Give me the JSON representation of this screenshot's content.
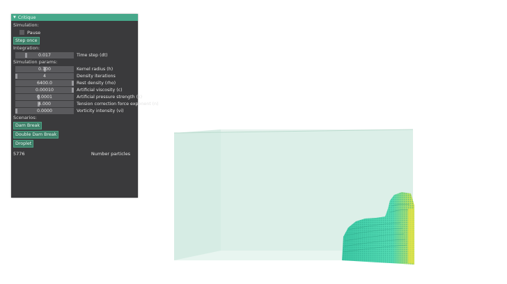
{
  "panel": {
    "title": "Critique",
    "sections": {
      "simulation": "Simulation:",
      "integration": "Integration:",
      "params": "Simulation params:",
      "scenarios": "Scenarios:"
    },
    "pause_label": "Pause",
    "step_once": "Step once",
    "time_step": {
      "value": "0.017",
      "label": "Time step (dt)",
      "level": 0.17
    },
    "params": [
      {
        "value": "0.100",
        "label": "Kernel radius (h)",
        "level": 0.5
      },
      {
        "value": "4",
        "label": "Density iterations",
        "level": 0.0
      },
      {
        "value": "6400.0",
        "label": "Rest density (rho)",
        "level": 1.0
      },
      {
        "value": "0.00010",
        "label": "Artificial viscosity (c)",
        "level": 1.0
      },
      {
        "value": "0.0001",
        "label": "Artificial pressure strength (k)",
        "level": 0.4
      },
      {
        "value": "4.000",
        "label": "Tension correction force exponent (n)",
        "level": 0.4
      },
      {
        "value": "0.0000",
        "label": "Vorticity intensity (vi)",
        "level": 0.0
      }
    ],
    "scenarios": [
      "Dam Break",
      "Double Dam Break",
      "Droplet"
    ],
    "particle_count": "5776",
    "particle_label": "Number particles"
  },
  "colors": {
    "accent": "#46a88a",
    "panel_bg": "#3a3a3c",
    "fluid": "#4ed6b0",
    "fluid_hot": "#e3e34a",
    "tank": "#cfe8de"
  }
}
